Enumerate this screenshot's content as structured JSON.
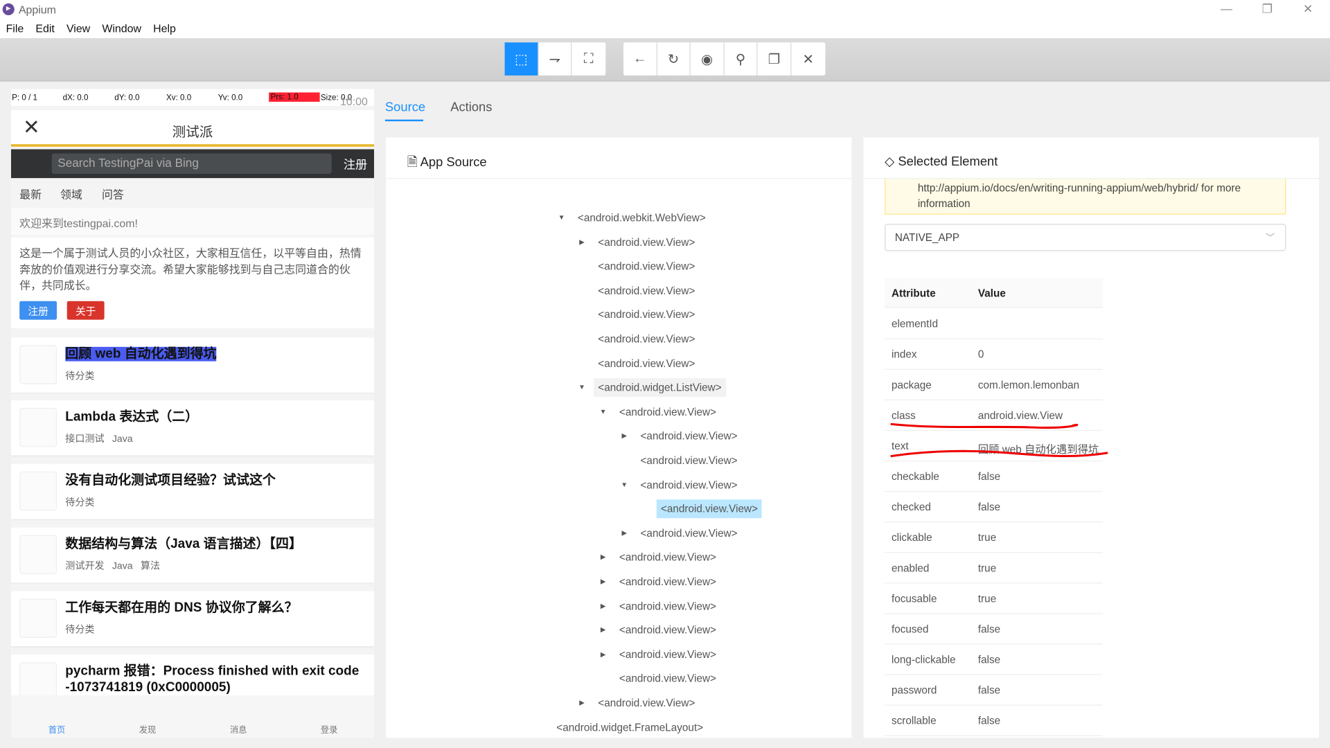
{
  "window": {
    "title": "Appium",
    "minimize": "—",
    "restore": "❐",
    "close": "✕"
  },
  "menu": [
    "File",
    "Edit",
    "View",
    "Window",
    "Help"
  ],
  "toolbar": {
    "group1": [
      {
        "icon": "select-element-icon",
        "glyph": "⬚"
      },
      {
        "icon": "swipe-icon",
        "glyph": "⇁"
      },
      {
        "icon": "tap-coordinates-icon",
        "glyph": "⛶"
      }
    ],
    "group2": [
      {
        "icon": "back-icon",
        "glyph": "←"
      },
      {
        "icon": "refresh-icon",
        "glyph": "↻"
      },
      {
        "icon": "eye-icon",
        "glyph": "◉"
      },
      {
        "icon": "search-icon",
        "glyph": "⚲"
      },
      {
        "icon": "copy-icon",
        "glyph": "❐"
      },
      {
        "icon": "close-icon",
        "glyph": "✕"
      }
    ],
    "accent": "#1890ff"
  },
  "device": {
    "pointer": {
      "p": "P: 0 / 1",
      "dx": "dX: 0.0",
      "dy": "dY: 0.0",
      "xv": "Xv: 0.0",
      "yv": "Yv: 0.0",
      "prs": "Prs: 1.0",
      "size": "Size: 0.0",
      "time": "10:00"
    },
    "header_title": "测试派",
    "search_placeholder": "Search TestingPai via Bing",
    "register": "注册",
    "tabs": [
      "最新",
      "领域",
      "问答"
    ],
    "welcome": "欢迎来到testingpai.com!",
    "description": "这是一个属于测试人员的小众社区，大家相互信任，以平等自由，热情奔放的价值观进行分享交流。希望大家能够找到与自己志同道合的伙伴，共同成长。",
    "btn_register": "注册",
    "btn_about": "关于",
    "articles": [
      {
        "title": "回顾 web 自动化遇到得坑",
        "tags": "待分类"
      },
      {
        "title": "Lambda 表达式（二）",
        "tags": "接口测试 Java"
      },
      {
        "title": "没有自动化测试项目经验？试试这个",
        "tags": "待分类"
      },
      {
        "title": "数据结构与算法（Java 语言描述）【四】",
        "tags": "测试开发 Java 算法"
      },
      {
        "title": "工作每天都在用的 DNS 协议你了解么？",
        "tags": "待分类"
      },
      {
        "title": "pycharm 报错：Process finished with exit code -1073741819 (0xC0000005)",
        "tags": ""
      }
    ],
    "nav": [
      "首页",
      "发现",
      "消息",
      "登录"
    ]
  },
  "tabs": {
    "source": "Source",
    "actions": "Actions"
  },
  "source": {
    "title": "App Source",
    "nodes": [
      {
        "label": "<android.webkit.WebView>",
        "level": 0,
        "arrow": "down"
      },
      {
        "label": "<android.view.View>",
        "level": 1,
        "arrow": "right"
      },
      {
        "label": "<android.view.View>",
        "level": 1,
        "arrow": ""
      },
      {
        "label": "<android.view.View>",
        "level": 1,
        "arrow": ""
      },
      {
        "label": "<android.view.View>",
        "level": 1,
        "arrow": ""
      },
      {
        "label": "<android.view.View>",
        "level": 1,
        "arrow": ""
      },
      {
        "label": "<android.view.View>",
        "level": 1,
        "arrow": ""
      },
      {
        "label": "<android.widget.ListView>",
        "level": 1,
        "arrow": "down",
        "state": "hover"
      },
      {
        "label": "<android.view.View>",
        "level": 2,
        "arrow": "down"
      },
      {
        "label": "<android.view.View>",
        "level": 3,
        "arrow": "right"
      },
      {
        "label": "<android.view.View>",
        "level": 3,
        "arrow": ""
      },
      {
        "label": "<android.view.View>",
        "level": 3,
        "arrow": "down"
      },
      {
        "label": "<android.view.View>",
        "level": 4,
        "arrow": "",
        "state": "selected"
      },
      {
        "label": "<android.view.View>",
        "level": 3,
        "arrow": "right"
      },
      {
        "label": "<android.view.View>",
        "level": 2,
        "arrow": "right"
      },
      {
        "label": "<android.view.View>",
        "level": 2,
        "arrow": "right"
      },
      {
        "label": "<android.view.View>",
        "level": 2,
        "arrow": "right"
      },
      {
        "label": "<android.view.View>",
        "level": 2,
        "arrow": "right"
      },
      {
        "label": "<android.view.View>",
        "level": 2,
        "arrow": "right"
      },
      {
        "label": "<android.view.View>",
        "level": 2,
        "arrow": ""
      },
      {
        "label": "<android.view.View>",
        "level": 1,
        "arrow": "right"
      },
      {
        "label": "<android.widget.FrameLayout>",
        "level": -1,
        "arrow": ""
      }
    ]
  },
  "selected": {
    "title": "Selected Element",
    "alert_line1": "http://appium.io/docs/en/writing-running-appium/web/hybrid/ for more",
    "alert_line2": "information",
    "context": "NATIVE_APP",
    "header": {
      "attr": "Attribute",
      "value": "Value"
    },
    "rows": [
      [
        "elementId",
        ""
      ],
      [
        "index",
        "0"
      ],
      [
        "package",
        "com.lemon.lemonban"
      ],
      [
        "class",
        "android.view.View"
      ],
      [
        "text",
        "回顾 web 自动化遇到得坑"
      ],
      [
        "checkable",
        "false"
      ],
      [
        "checked",
        "false"
      ],
      [
        "clickable",
        "true"
      ],
      [
        "enabled",
        "true"
      ],
      [
        "focusable",
        "true"
      ],
      [
        "focused",
        "false"
      ],
      [
        "long-clickable",
        "false"
      ],
      [
        "password",
        "false"
      ],
      [
        "scrollable",
        "false"
      ]
    ]
  }
}
